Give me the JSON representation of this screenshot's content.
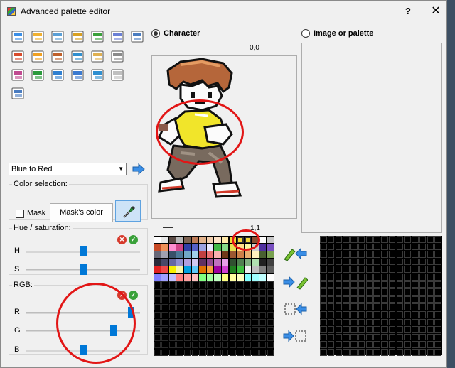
{
  "window": {
    "title": "Advanced palette editor",
    "help": "?",
    "close": "✕"
  },
  "tools": [
    "open-palette-icon",
    "edit-icon",
    "save-icon",
    "zoom-in-icon",
    "zoom-out-icon",
    "import-icon",
    "grid-icon",
    "undo-icon",
    "redo-icon",
    "copy-palette-icon",
    "paste-palette-icon",
    "list-icon",
    "gradient-icon",
    "apply-icon",
    "color-swap-icon",
    "remap-icon",
    "image-icon",
    "refresh-icon",
    "tile-icon",
    "screen-icon"
  ],
  "gradient": {
    "selected": "Blue to Red"
  },
  "color_selection": {
    "legend": "Color selection:",
    "mask_label": "Mask",
    "mask_color_button": "Mask's color"
  },
  "hue_saturation": {
    "legend": "Hue / saturation:",
    "h_label": "H",
    "s_label": "S",
    "h_value": 0.5,
    "s_value": 0.5
  },
  "rgb": {
    "legend": "RGB:",
    "r_label": "R",
    "g_label": "G",
    "b_label": "B",
    "r_value": 0.95,
    "g_value": 0.78,
    "b_value": 0.5
  },
  "character": {
    "label": "Character",
    "coord": "0,0"
  },
  "image_palette": {
    "label": "Image or palette"
  },
  "palette": {
    "coord": "1,1"
  },
  "colors": {
    "selection_blue": "#0078d7",
    "annotation_red": "#e21616",
    "palette_rows": [
      [
        "#ffffff",
        "#e8e8e8",
        "#5a4a44",
        "#b8b8b8",
        "#7c6252",
        "#bd7a56",
        "#e3b38c",
        "#f2cfae",
        "#fde3c8",
        "#ffe9a8",
        "#f2d838",
        "#ff00ff",
        "#9c2a2a",
        "#8b4d2f",
        "#fcfcfc",
        "#c8c8c8"
      ],
      [
        "#c84a26",
        "#f09058",
        "#ff8ed0",
        "#d04488",
        "#3040a8",
        "#5560c8",
        "#9ca2e0",
        "#e8e8ff",
        "#40b848",
        "#85d888",
        "#e8e050",
        "#ffe08c",
        "#f8f8a0",
        "#d0d0d0",
        "#5030a0",
        "#7850c0"
      ],
      [
        "#686878",
        "#a0a0b0",
        "#385068",
        "#4c7898",
        "#70a8c8",
        "#a0d0e8",
        "#c04040",
        "#e87070",
        "#f8b0b0",
        "#703818",
        "#9c5830",
        "#cc8048",
        "#e8b070",
        "#fff0c0",
        "#486030",
        "#78a050"
      ],
      [
        "#2a2a3a",
        "#484868",
        "#6868a0",
        "#9090d0",
        "#b0a0e0",
        "#d0c8f0",
        "#603060",
        "#904890",
        "#c070c0",
        "#e8a0e8",
        "#305030",
        "#508050",
        "#80b080",
        "#b0e0b0",
        "#202020",
        "#404040"
      ],
      [
        "#e02020",
        "#f04848",
        "#f8f000",
        "#f8f8a8",
        "#00a0e0",
        "#60c8f8",
        "#e07000",
        "#f8a040",
        "#a000a0",
        "#d040d0",
        "#208020",
        "#40c040",
        "#f0f0f0",
        "#c0c0c0",
        "#808080",
        "#606060"
      ],
      [
        "#8080ff",
        "#a0a0ff",
        "#c0c0ff",
        "#ff8080",
        "#ffa0a0",
        "#ffc0c0",
        "#80ff80",
        "#a0ffa0",
        "#c0ffc0",
        "#ffff80",
        "#ffffa0",
        "#ffffc0",
        "#80ffff",
        "#a0ffff",
        "#c0ffff",
        "#ffffff"
      ]
    ]
  }
}
